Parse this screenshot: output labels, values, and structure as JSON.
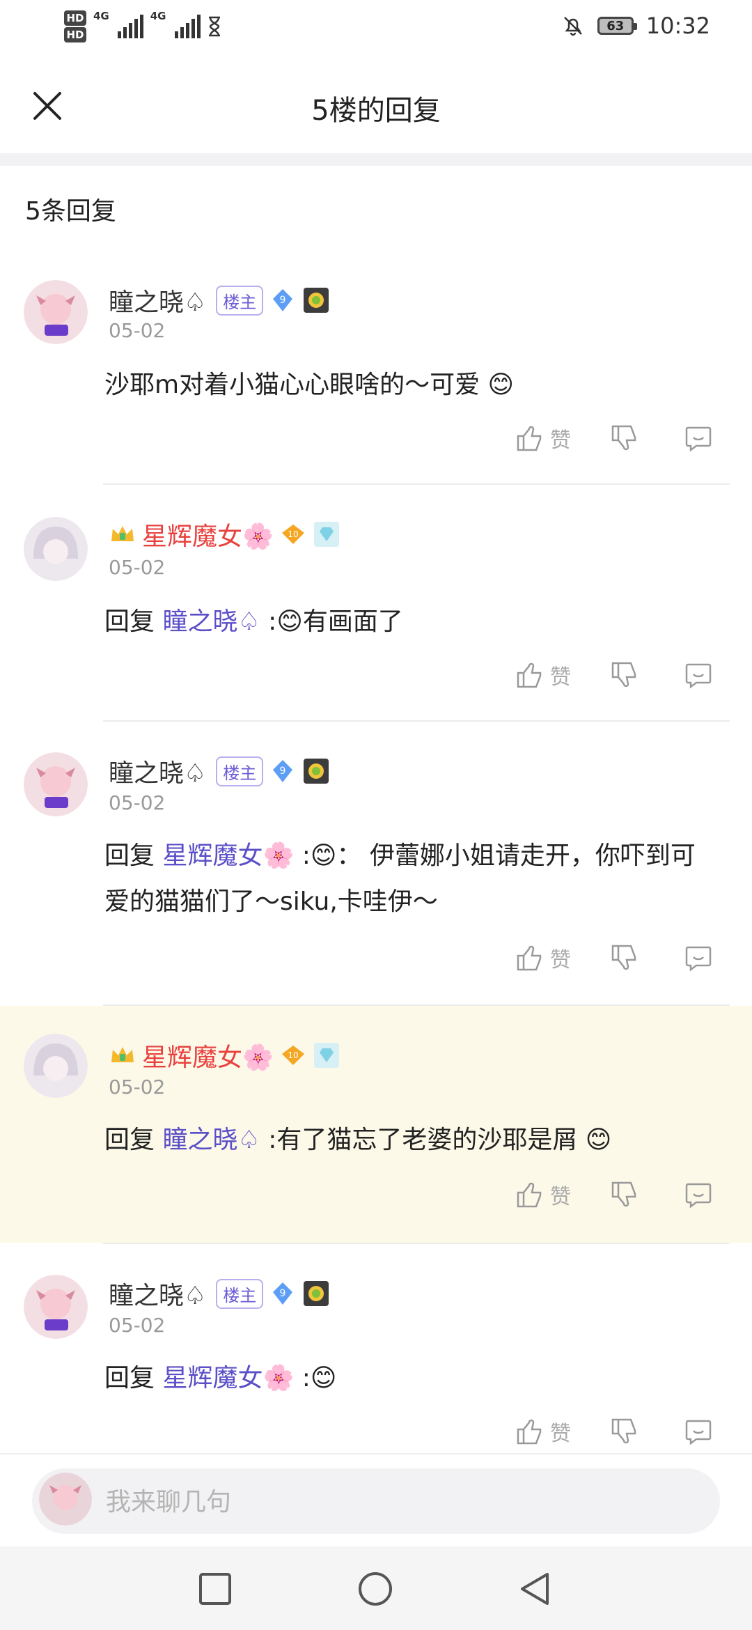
{
  "status_bar": {
    "hd1": "HD",
    "hd2": "HD",
    "net1": "4G",
    "net2": "4G",
    "battery": "63",
    "time": "10:32"
  },
  "header": {
    "title": "5楼的回复"
  },
  "reply_count": "5条回复",
  "comments": [
    {
      "user": "瞳之晓♤",
      "tag": "楼主",
      "level": "9",
      "date": "05-02",
      "text": "沙耶m对着小猫心心眼啥的～可爱",
      "like_label": "赞"
    },
    {
      "user": "星辉魔女🌸",
      "level": "10",
      "date": "05-02",
      "prefix": "回复 ",
      "mention": "瞳之晓♤",
      "text": "有画面了",
      "like_label": "赞"
    },
    {
      "user": "瞳之晓♤",
      "tag": "楼主",
      "level": "9",
      "date": "05-02",
      "prefix": "回复 ",
      "mention": "星辉魔女🌸",
      "text": "： 伊蕾娜小姐请走开，你吓到可爱的猫猫们了～siku,卡哇伊～",
      "like_label": "赞"
    },
    {
      "user": "星辉魔女🌸",
      "level": "10",
      "date": "05-02",
      "prefix": "回复 ",
      "mention": "瞳之晓♤",
      "text": ":有了猫忘了老婆的沙耶是屑",
      "like_label": "赞"
    },
    {
      "user": "瞳之晓♤",
      "tag": "楼主",
      "level": "9",
      "date": "05-02",
      "prefix": "回复 ",
      "mention": "星辉魔女🌸",
      "text": "",
      "like_label": "赞"
    }
  ],
  "input": {
    "placeholder": "我来聊几句"
  },
  "colors": {
    "accent": "#5b4fc7",
    "red_name": "#e8423f",
    "highlight": "#fcf9e9"
  },
  "icons": [
    "close-icon",
    "like-icon",
    "dislike-icon",
    "comment-icon",
    "crown-icon",
    "gem-badge-icon",
    "sun-badge-icon",
    "smile-emoji-icon",
    "square-nav-icon",
    "circle-nav-icon",
    "back-nav-icon"
  ]
}
